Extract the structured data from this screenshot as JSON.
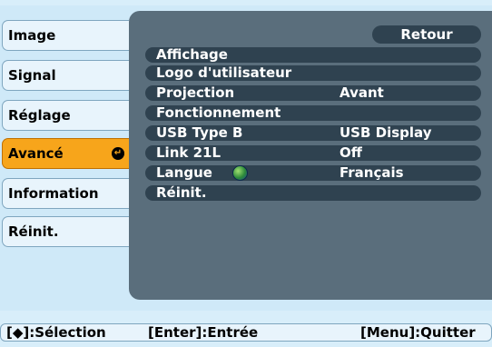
{
  "menu": {
    "items": [
      {
        "label": "Image"
      },
      {
        "label": "Signal"
      },
      {
        "label": "Réglage"
      },
      {
        "label": "Avancé",
        "active": true
      },
      {
        "label": "Information"
      },
      {
        "label": "Réinit."
      }
    ],
    "active_color": "#f7a51b"
  },
  "panel": {
    "back_label": "Retour",
    "rows": [
      {
        "label": "Affichage",
        "value": ""
      },
      {
        "label": "Logo d'utilisateur",
        "value": ""
      },
      {
        "label": "Projection",
        "value": "Avant"
      },
      {
        "label": "Fonctionnement",
        "value": ""
      },
      {
        "label": "USB Type B",
        "value": "USB Display"
      },
      {
        "label": "Link 21L",
        "value": "Off"
      },
      {
        "label": "Langue",
        "value": "Français",
        "icon": "globe-icon"
      },
      {
        "label": "Réinit.",
        "value": ""
      }
    ]
  },
  "help_bar": {
    "select": "[◆]:Sélection",
    "enter": "[Enter]:Entrée",
    "quit": "[Menu]:Quitter"
  }
}
